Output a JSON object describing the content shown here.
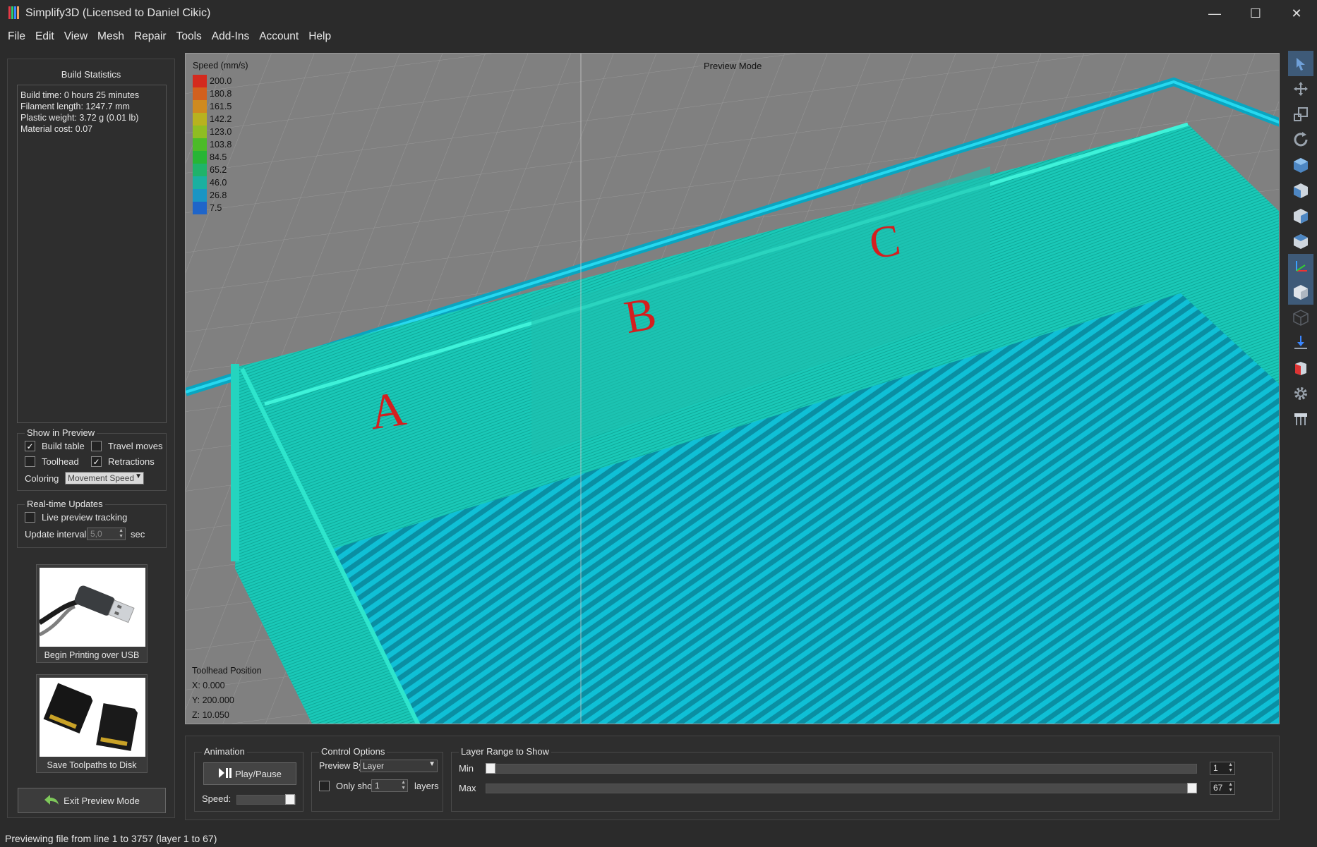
{
  "window": {
    "title": "Simplify3D (Licensed to Daniel Cikic)",
    "minimize": "—",
    "maximize": "☐",
    "close": "✕",
    "logo_colors": [
      "#e63946",
      "#2ecc71",
      "#3a86ff",
      "#f4a261"
    ]
  },
  "menu": [
    "File",
    "Edit",
    "View",
    "Mesh",
    "Repair",
    "Tools",
    "Add-Ins",
    "Account",
    "Help"
  ],
  "build_statistics": {
    "title": "Build Statistics",
    "lines": [
      "Build time: 0 hours 25 minutes",
      "Filament length: 1247.7 mm",
      "Plastic weight: 3.72 g (0.01 lb)",
      "Material cost: 0.07"
    ]
  },
  "show_in_preview": {
    "title": "Show in Preview",
    "build_table": {
      "label": "Build table",
      "checked": true
    },
    "travel_moves": {
      "label": "Travel moves",
      "checked": false
    },
    "toolhead": {
      "label": "Toolhead",
      "checked": false
    },
    "retractions": {
      "label": "Retractions",
      "checked": true
    },
    "coloring_label": "Coloring",
    "coloring_value": "Movement Speed"
  },
  "realtime": {
    "title": "Real-time Updates",
    "live_tracking": {
      "label": "Live preview tracking",
      "checked": false
    },
    "interval_label": "Update interval",
    "interval_value": "5,0",
    "interval_unit": "sec"
  },
  "usb_button": {
    "label": "Begin Printing over USB"
  },
  "sd_button": {
    "label": "Save Toolpaths to Disk"
  },
  "exit_button": {
    "label": "Exit Preview Mode"
  },
  "viewport": {
    "mode_label": "Preview Mode",
    "legend_title": "Speed (mm/s)",
    "legend": [
      {
        "value": "200.0",
        "color": "#d42a1e"
      },
      {
        "value": "180.8",
        "color": "#d2601e"
      },
      {
        "value": "161.5",
        "color": "#cf8a1f"
      },
      {
        "value": "142.2",
        "color": "#b8b21f"
      },
      {
        "value": "123.0",
        "color": "#8fbd22"
      },
      {
        "value": "103.8",
        "color": "#4cbb28"
      },
      {
        "value": "84.5",
        "color": "#27b535"
      },
      {
        "value": "65.2",
        "color": "#1fb36a"
      },
      {
        "value": "46.0",
        "color": "#1ab0a0"
      },
      {
        "value": "26.8",
        "color": "#1a95c4"
      },
      {
        "value": "7.5",
        "color": "#1f65c9"
      }
    ],
    "toolhead_title": "Toolhead Position",
    "x": "X: 0.000",
    "y": "Y: 200.000",
    "z": "Z: 10.050",
    "letters": [
      "A",
      "B",
      "C"
    ]
  },
  "animation": {
    "title": "Animation",
    "play_label": "Play/Pause",
    "speed_label": "Speed:"
  },
  "control_options": {
    "title": "Control Options",
    "preview_by_label": "Preview By",
    "preview_by_value": "Layer",
    "only_show_label": "Only show",
    "only_show_value": "1",
    "layers_label": "layers"
  },
  "layer_range": {
    "title": "Layer Range to Show",
    "min_label": "Min",
    "max_label": "Max",
    "min_value": "1",
    "max_value": "67",
    "total_layers": 67
  },
  "status": "Previewing file from line 1 to 3757 (layer 1 to 67)"
}
